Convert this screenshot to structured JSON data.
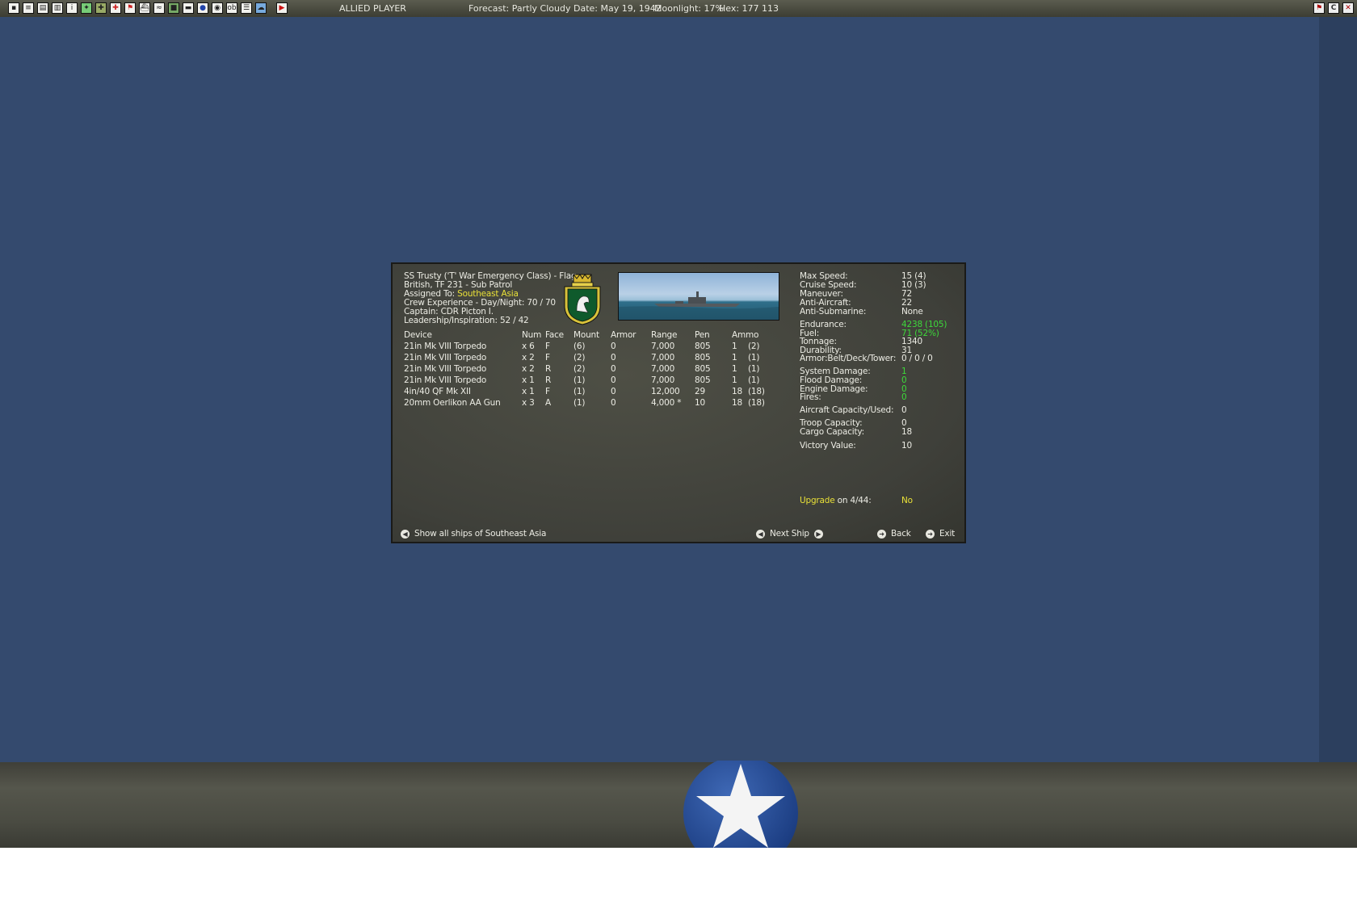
{
  "topbar": {
    "player": "ALLIED PLAYER",
    "forecast": "Forecast: Partly Cloudy",
    "date": "Date: May 19, 1942",
    "moonlight": "Moonlight: 17%",
    "hex": "Hex: 177 113"
  },
  "ship": {
    "title": "SS Trusty ('T' War Emergency Class) - Flag",
    "line2": "British, TF 231 - Sub Patrol",
    "assigned_label": "Assigned To:",
    "assigned_value": "Southeast Asia",
    "crew": "Crew Experience - Day/Night: 70 / 70",
    "captain": "Captain: CDR Picton I.",
    "leadership": "Leadership/Inspiration: 52 / 42"
  },
  "devices": {
    "headers": [
      "Device",
      "Num",
      "Face",
      "Mount",
      "Armor",
      "Range",
      "Pen",
      "Ammo"
    ],
    "rows": [
      [
        "21in Mk VIII Torpedo",
        "x 6",
        "F",
        "(6)",
        "0",
        "7,000",
        "805",
        "1",
        "(2)"
      ],
      [
        "21in Mk VIII Torpedo",
        "x 2",
        "F",
        "(2)",
        "0",
        "7,000",
        "805",
        "1",
        "(1)"
      ],
      [
        "21in Mk VIII Torpedo",
        "x 2",
        "R",
        "(2)",
        "0",
        "7,000",
        "805",
        "1",
        "(1)"
      ],
      [
        "21in Mk VIII Torpedo",
        "x 1",
        "R",
        "(1)",
        "0",
        "7,000",
        "805",
        "1",
        "(1)"
      ],
      [
        "4in/40 QF Mk XII",
        "x 1",
        "F",
        "(1)",
        "0",
        "12,000",
        "29",
        "18",
        "(18)"
      ],
      [
        "20mm Oerlikon AA Gun",
        "x 3",
        "A",
        "(1)",
        "0",
        "4,000 *",
        "10",
        "18",
        "(18)"
      ]
    ]
  },
  "stats": [
    {
      "label": "Max Speed:",
      "value": "15 (4)",
      "color": "#ecece4"
    },
    {
      "label": "Cruise Speed:",
      "value": "10 (3)",
      "color": "#ecece4"
    },
    {
      "label": "Maneuver:",
      "value": "72",
      "color": "#ecece4"
    },
    {
      "label": "Anti-Aircraft:",
      "value": "22",
      "color": "#ecece4"
    },
    {
      "label": "Anti-Submarine:",
      "value": "None",
      "color": "#ecece4"
    },
    {
      "label": "Endurance:",
      "value": "4238 (105)",
      "color": "#3dd83a"
    },
    {
      "label": "Fuel:",
      "value": "71 (52%)",
      "color": "#3dd83a"
    },
    {
      "label": "Tonnage:",
      "value": "1340",
      "color": "#ecece4"
    },
    {
      "label": "Durability:",
      "value": "31",
      "color": "#ecece4"
    },
    {
      "label": "Armor:Belt/Deck/Tower:",
      "value": "0 / 0 / 0",
      "color": "#ecece4"
    },
    {
      "label": "System Damage:",
      "value": "1",
      "color": "#3dd83a"
    },
    {
      "label": "Flood Damage:",
      "value": "0",
      "color": "#3dd83a"
    },
    {
      "label": "Engine Damage:",
      "value": "0",
      "color": "#3dd83a"
    },
    {
      "label": "Fires:",
      "value": "0",
      "color": "#3dd83a"
    },
    {
      "label": "Aircraft Capacity/Used:",
      "value": "0",
      "color": "#ecece4"
    },
    {
      "label": "Troop Capacity:",
      "value": "0",
      "color": "#ecece4"
    },
    {
      "label": "Cargo Capacity:",
      "value": "18",
      "color": "#ecece4"
    },
    {
      "label": "Victory Value:",
      "value": "10",
      "color": "#ecece4"
    }
  ],
  "upgrade": {
    "label": "Upgrade",
    "on": "on 4/44:",
    "value": "No"
  },
  "buttons": {
    "show_all": "Show all ships of Southeast Asia",
    "next_ship": "Next Ship",
    "back": "Back",
    "exit": "Exit"
  },
  "colors": {
    "map": "#344a6e",
    "dialog": "#45463e",
    "highlight_yellow": "#e8e038",
    "highlight_green": "#3dd83a"
  }
}
